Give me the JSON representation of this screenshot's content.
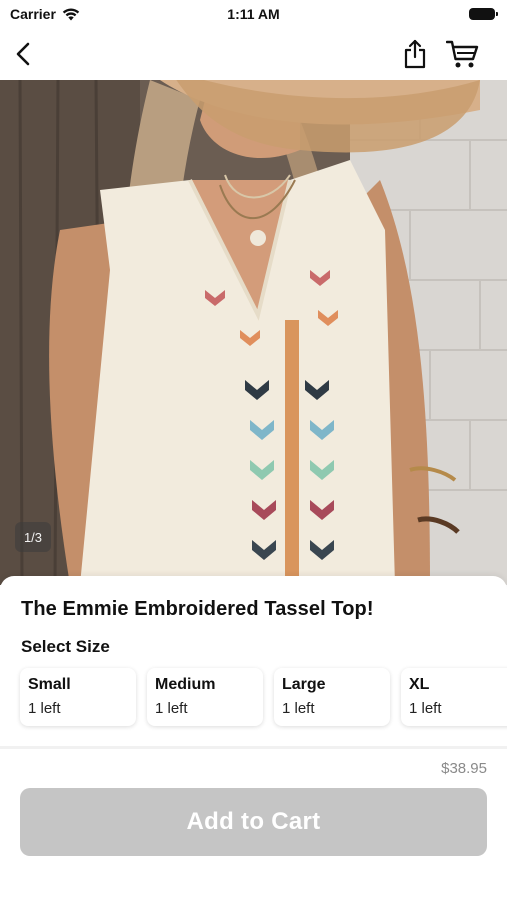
{
  "status_bar": {
    "carrier": "Carrier",
    "time": "1:11 AM"
  },
  "nav": {
    "back_icon": "chevron-left-icon",
    "share_icon": "share-icon",
    "cart_icon": "cart-icon"
  },
  "gallery": {
    "counter": "1/3"
  },
  "product": {
    "title": "The Emmie Embroidered Tassel Top!",
    "size_heading": "Select Size",
    "sizes": [
      {
        "name": "Small",
        "stock": "1 left"
      },
      {
        "name": "Medium",
        "stock": "1 left"
      },
      {
        "name": "Large",
        "stock": "1 left"
      },
      {
        "name": "XL",
        "stock": "1 left"
      }
    ],
    "price": "$38.95",
    "add_to_cart_label": "Add to Cart"
  },
  "colors": {
    "button_disabled": "#c5c5c5",
    "price_text": "#8a8a8a"
  }
}
